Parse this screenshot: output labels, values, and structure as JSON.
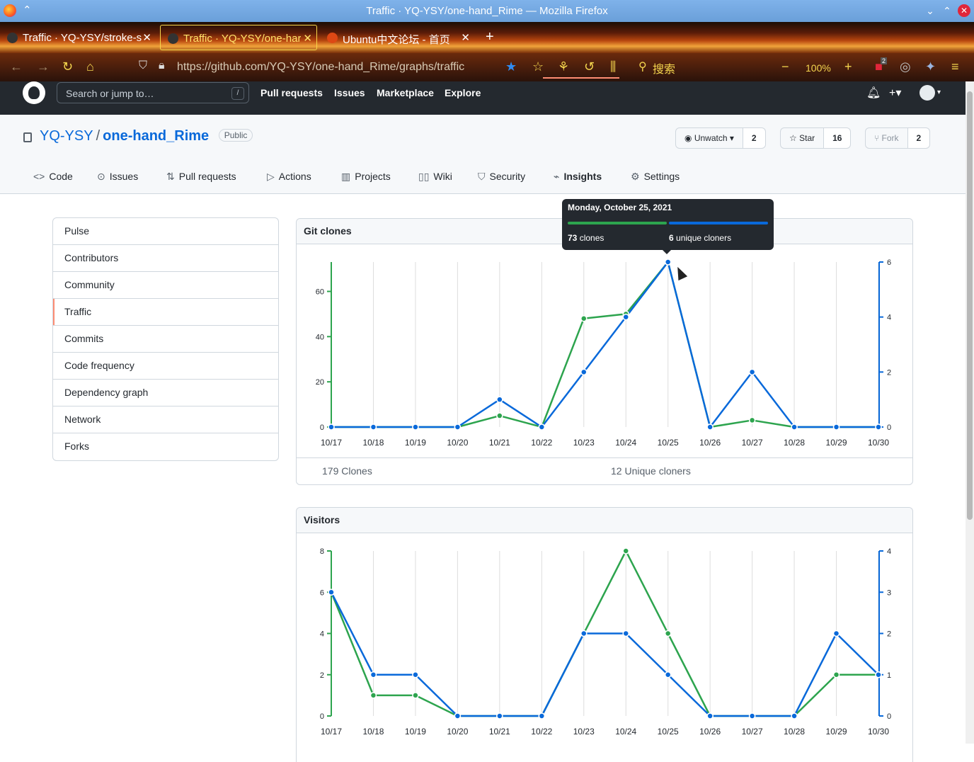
{
  "window": {
    "title": "Traffic · YQ-YSY/one-hand_Rime — Mozilla Firefox"
  },
  "tabs": [
    {
      "label": "Traffic · YQ-YSY/stroke-s"
    },
    {
      "label": "Traffic · YQ-YSY/one-har"
    },
    {
      "label": "Ubuntu中文论坛 - 首页"
    }
  ],
  "urlbar": {
    "url": "https://github.com/YQ-YSY/one-hand_Rime/graphs/traffic",
    "search_label": "搜索",
    "zoom": "100%",
    "badge_count": "2"
  },
  "gh_header": {
    "search_placeholder": "Search or jump to…",
    "search_shortcut": "/",
    "nav": [
      "Pull requests",
      "Issues",
      "Marketplace",
      "Explore"
    ]
  },
  "repo": {
    "owner": "YQ-YSY",
    "separator": "/",
    "name": "one-hand_Rime",
    "visibility": "Public",
    "watch_label": "Unwatch",
    "watch_count": "2",
    "star_label": "Star",
    "star_count": "16",
    "fork_label": "Fork",
    "fork_count": "2",
    "tabs": [
      "Code",
      "Issues",
      "Pull requests",
      "Actions",
      "Projects",
      "Wiki",
      "Security",
      "Insights",
      "Settings"
    ],
    "selected_tab": "Insights"
  },
  "sidebar": {
    "items": [
      "Pulse",
      "Contributors",
      "Community",
      "Traffic",
      "Commits",
      "Code frequency",
      "Dependency graph",
      "Network",
      "Forks"
    ],
    "selected": "Traffic"
  },
  "clones_panel": {
    "title": "Git clones",
    "total_label": "179 Clones",
    "unique_label": "12 Unique cloners"
  },
  "visitors_panel": {
    "title": "Visitors"
  },
  "tooltip": {
    "date": "Monday, October 25, 2021",
    "clones_count": "73",
    "clones_label": "clones",
    "unique_count": "6",
    "unique_label": "unique cloners"
  },
  "colors": {
    "green": "#2da44e",
    "blue": "#0969da"
  },
  "chart_data": [
    {
      "type": "line",
      "title": "Git clones",
      "categories": [
        "10/17",
        "10/18",
        "10/19",
        "10/20",
        "10/21",
        "10/22",
        "10/23",
        "10/24",
        "10/25",
        "10/26",
        "10/27",
        "10/28",
        "10/29",
        "10/30"
      ],
      "series": [
        {
          "name": "clones",
          "axis": "left",
          "color": "#2da44e",
          "values": [
            0,
            0,
            0,
            0,
            5,
            0,
            48,
            50,
            73,
            0,
            3,
            0,
            0,
            0
          ]
        },
        {
          "name": "unique cloners",
          "axis": "right",
          "color": "#0969da",
          "values": [
            0,
            0,
            0,
            0,
            1,
            0,
            2,
            4,
            6,
            0,
            2,
            0,
            0,
            0
          ]
        }
      ],
      "left_ticks": [
        0,
        20,
        40,
        60
      ],
      "left_ylim": [
        0,
        73
      ],
      "right_ticks": [
        0,
        2,
        4,
        6
      ],
      "right_ylim": [
        0,
        6
      ],
      "grid": "vertical"
    },
    {
      "type": "line",
      "title": "Visitors",
      "categories": [
        "10/17",
        "10/18",
        "10/19",
        "10/20",
        "10/21",
        "10/22",
        "10/23",
        "10/24",
        "10/25",
        "10/26",
        "10/27",
        "10/28",
        "10/29",
        "10/30"
      ],
      "series": [
        {
          "axis": "left",
          "color": "#2da44e",
          "values": [
            6,
            1,
            1,
            0,
            0,
            0,
            4,
            8,
            4,
            0,
            0,
            0,
            2,
            2
          ]
        },
        {
          "axis": "right",
          "color": "#0969da",
          "values": [
            3,
            1,
            1,
            0,
            0,
            0,
            2,
            2,
            1,
            0,
            0,
            0,
            2,
            1
          ]
        }
      ],
      "left_ticks": [
        0,
        2,
        4,
        6,
        8
      ],
      "left_ylim": [
        0,
        8
      ],
      "right_ticks": [
        0,
        1,
        2,
        3,
        4
      ],
      "right_ylim": [
        0,
        4
      ],
      "grid": "vertical"
    }
  ]
}
